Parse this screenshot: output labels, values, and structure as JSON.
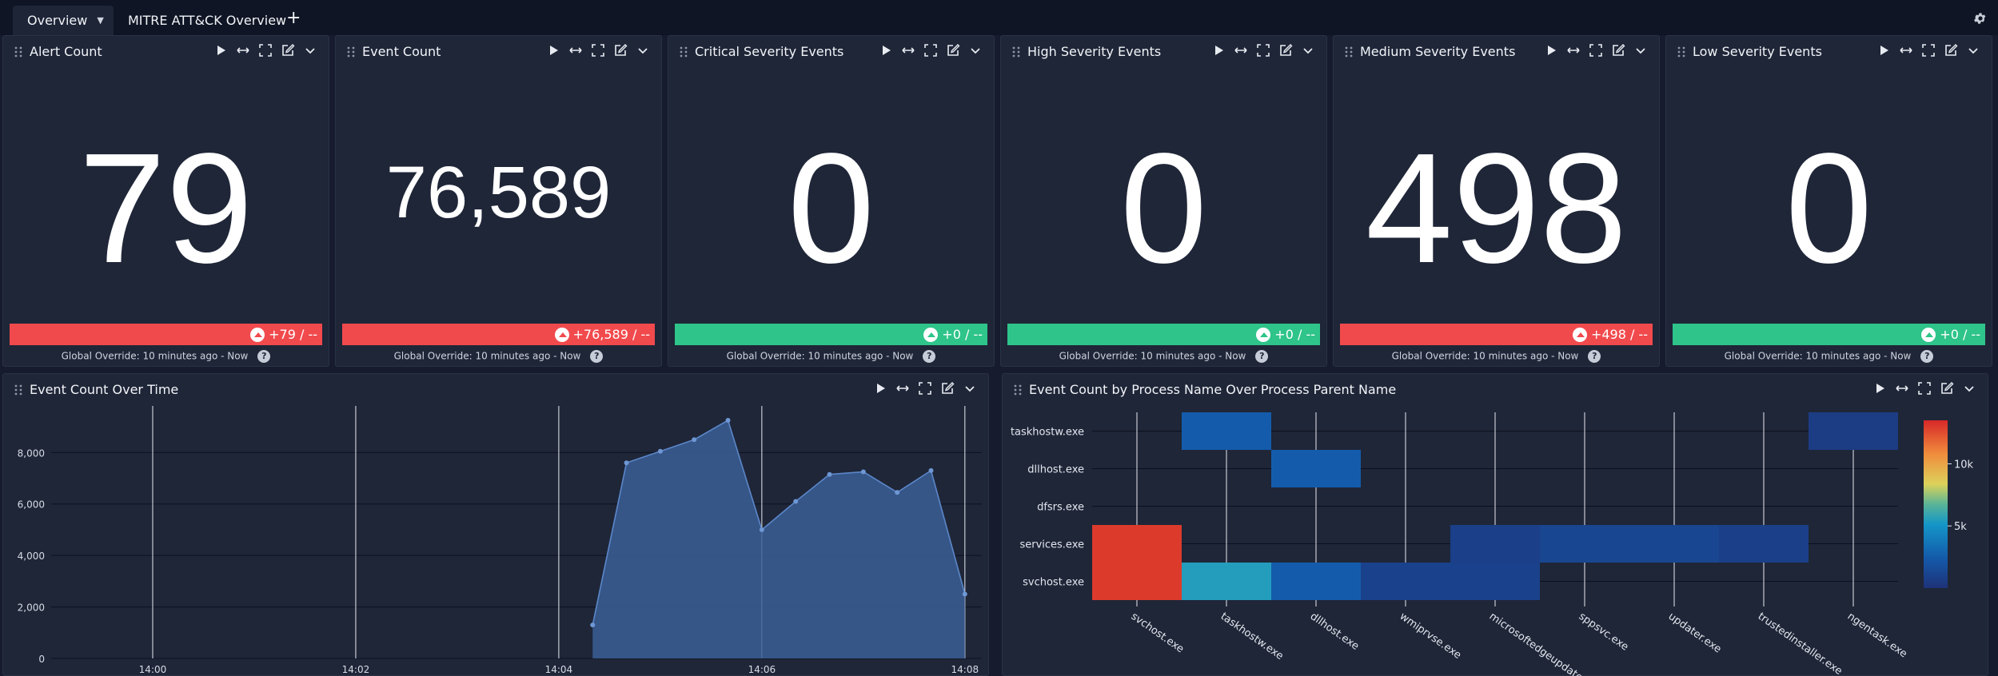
{
  "tabs": {
    "active_label": "Overview",
    "second_label": "MITRE ATT&CK Overview",
    "add_label": "+"
  },
  "stats": [
    {
      "title": "Alert Count",
      "value": "79",
      "delta": "+79 / --",
      "delta_color": "#f14a4d",
      "footer": "Global Override: 10 minutes ago - Now"
    },
    {
      "title": "Event Count",
      "value": "76,589",
      "delta": "+76,589 / --",
      "delta_color": "#f14a4d",
      "footer": "Global Override: 10 minutes ago - Now"
    },
    {
      "title": "Critical Severity Events",
      "value": "0",
      "delta": "+0 / --",
      "delta_color": "#2ec48a",
      "footer": "Global Override: 10 minutes ago - Now"
    },
    {
      "title": "High Severity Events",
      "value": "0",
      "delta": "+0 / --",
      "delta_color": "#2ec48a",
      "footer": "Global Override: 10 minutes ago - Now"
    },
    {
      "title": "Medium Severity Events",
      "value": "498",
      "delta": "+498 / --",
      "delta_color": "#f14a4d",
      "footer": "Global Override: 10 minutes ago - Now"
    },
    {
      "title": "Low Severity Events",
      "value": "0",
      "delta": "+0 / --",
      "delta_color": "#2ec48a",
      "footer": "Global Override: 10 minutes ago - Now"
    }
  ],
  "help_glyph": "?",
  "line_panel": {
    "title": "Event Count Over Time"
  },
  "heat_panel": {
    "title": "Event Count by Process Name Over Process Parent Name"
  },
  "chart_data": [
    {
      "type": "area",
      "title": "",
      "xlabel": "",
      "ylabel": "",
      "x_ticks": [
        "14:00",
        "14:02",
        "14:04",
        "14:06",
        "14:08"
      ],
      "y_ticks": [
        "0",
        "2,000",
        "4,000",
        "6,000",
        "8,000"
      ],
      "ylim": [
        0,
        9500
      ],
      "x_range": [
        "13:59:00",
        "14:08:10"
      ],
      "grid": true,
      "color": "#3b5f97",
      "series": [
        {
          "x": [
            "14:04:20",
            "14:04:40",
            "14:05:00",
            "14:05:20",
            "14:05:40",
            "14:06:00",
            "14:06:20",
            "14:06:40",
            "14:07:00",
            "14:07:20",
            "14:07:40",
            "14:08:00"
          ],
          "values": [
            1300,
            7600,
            8050,
            8500,
            9250,
            5000,
            6100,
            7150,
            7250,
            6450,
            7300,
            2500
          ]
        }
      ]
    },
    {
      "type": "heatmap",
      "title": "",
      "rows": [
        "taskhostw.exe",
        "dllhost.exe",
        "dfsrs.exe",
        "services.exe",
        "svchost.exe"
      ],
      "columns": [
        "svchost.exe",
        "taskhostw.exe",
        "dllhost.exe",
        "wmiprvse.exe",
        "microsoftedgeupdate.exe",
        "sppsvc.exe",
        "updater.exe",
        "trustedinstaller.exe",
        "ngentask.exe"
      ],
      "values": [
        [
          null,
          2500,
          null,
          null,
          null,
          null,
          null,
          null,
          600
        ],
        [
          null,
          null,
          2500,
          null,
          null,
          null,
          null,
          null,
          null
        ],
        [
          null,
          null,
          null,
          null,
          null,
          null,
          null,
          null,
          null
        ],
        [
          13000,
          null,
          null,
          null,
          800,
          1200,
          1200,
          800,
          null
        ],
        [
          13000,
          5500,
          2500,
          900,
          900,
          null,
          null,
          null,
          null
        ]
      ],
      "colorbar_ticks": [
        "5k",
        "10k"
      ],
      "color_range": [
        0,
        13500
      ]
    }
  ]
}
